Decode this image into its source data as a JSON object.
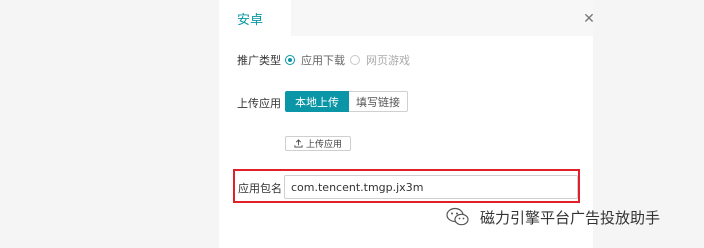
{
  "tabs": {
    "active_label": "安卓"
  },
  "form": {
    "promo_type": {
      "label": "推广类型",
      "options": [
        {
          "label": "应用下载",
          "checked": true
        },
        {
          "label": "网页游戏",
          "checked": false
        }
      ]
    },
    "upload_app": {
      "label": "上传应用",
      "segments": [
        "本地上传",
        "填写链接"
      ],
      "active_segment": "本地上传",
      "upload_button_label": "上传应用"
    },
    "package_name": {
      "label": "应用包名",
      "value": "com.tencent.tmgp.jx3m"
    }
  },
  "watermark": {
    "text": "磁力引擎平台广告投放助手"
  },
  "colors": {
    "accent": "#0a96a6",
    "highlight": "#e0202a"
  }
}
